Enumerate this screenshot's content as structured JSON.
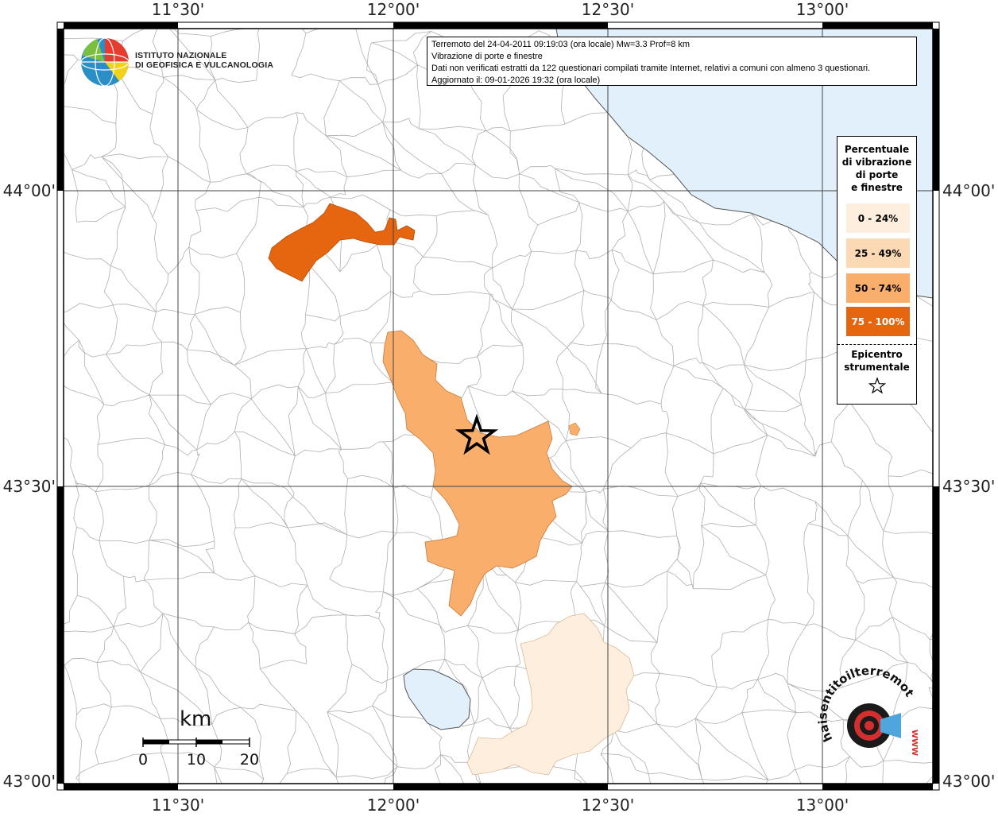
{
  "info": {
    "line1": "Terremoto del 24-04-2011 09:19:03 (ora locale) Mw=3.3 Prof=8 km",
    "line2": "Vibrazione di porte e finestre",
    "line3": "Dati non verificati estratti da 122 questionari compilati tramite Internet, relativi a comuni con almeno 3 questionari.",
    "line4": "Aggiornato il: 09-01-2026 19:32 (ora locale)"
  },
  "logo": {
    "line1": "ISTITUTO NAZIONALE",
    "line2": "DI GEOFISICA E VULCANOLOGIA"
  },
  "axes": {
    "longitude_labels": [
      "11°30'",
      "12°00'",
      "12°30'",
      "13°00'"
    ],
    "latitude_labels": [
      "44°00'",
      "43°30'",
      "43°00'"
    ]
  },
  "legend": {
    "title": [
      "Percentuale",
      "di vibrazione",
      "di porte",
      "e finestre"
    ],
    "classes": [
      {
        "label": "0 - 24%",
        "color": "#fdeedd",
        "text_color": "#000000"
      },
      {
        "label": "25 - 49%",
        "color": "#fcd9b5",
        "text_color": "#000000"
      },
      {
        "label": "50 - 74%",
        "color": "#f9ae6b",
        "text_color": "#000000"
      },
      {
        "label": "75 - 100%",
        "color": "#e5660f",
        "text_color": "#ffffff"
      }
    ],
    "epicenter_label": [
      "Epicentro",
      "strumentale"
    ],
    "epicenter_icon": "star-icon"
  },
  "scale": {
    "unit": "km",
    "ticks": [
      "0",
      "10",
      "20"
    ]
  },
  "watermark": {
    "text": "haisentitoilterremoto.it",
    "brand": "www.haisentitoilterremoto.it"
  },
  "colors": {
    "sea": "#e1f0fb",
    "boundary": "#b0b0b0",
    "grid": "#444444",
    "frame": "#000000"
  }
}
